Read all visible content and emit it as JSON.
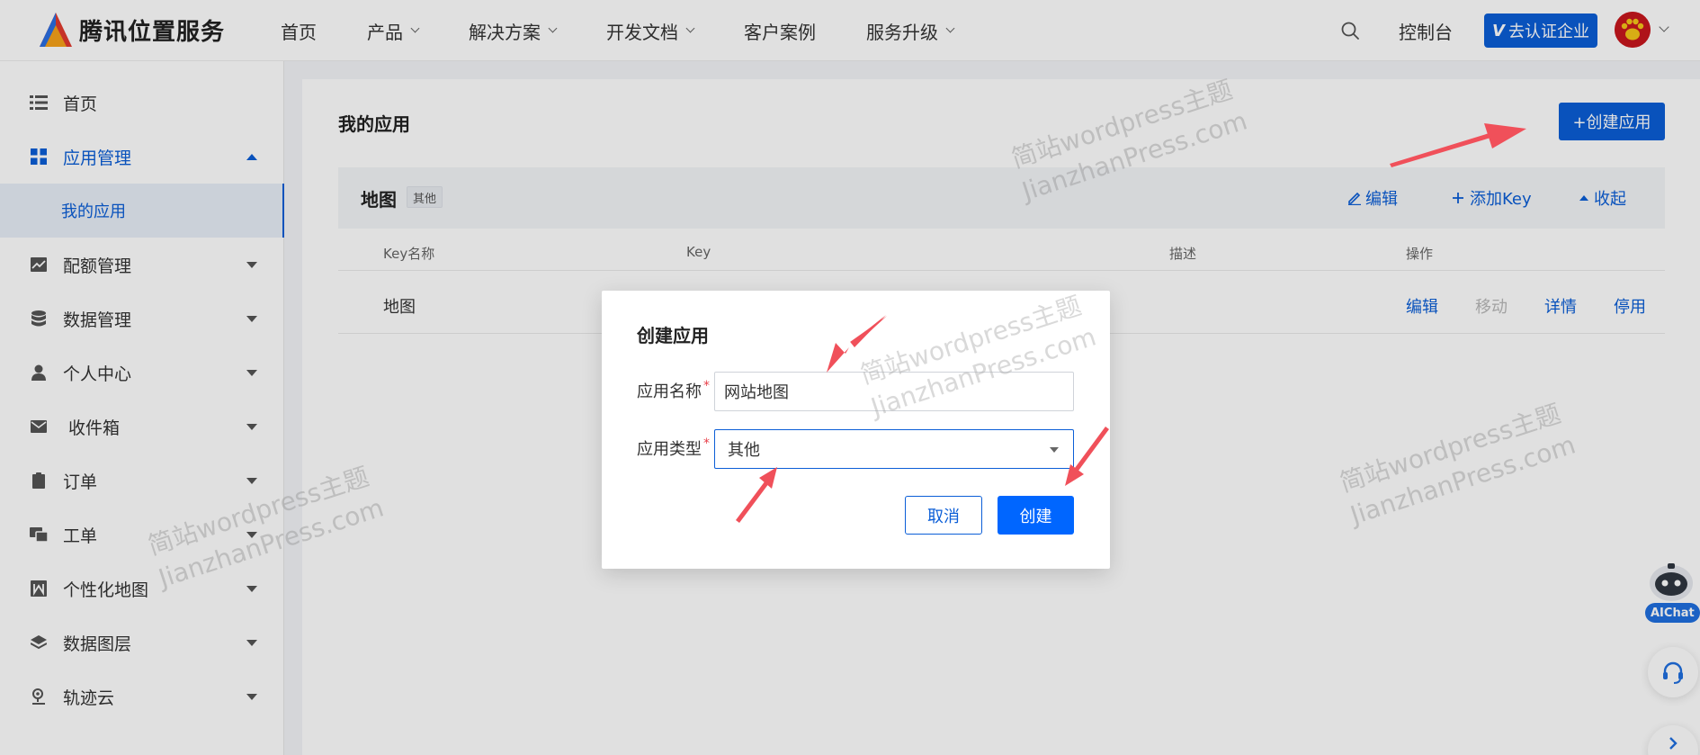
{
  "header": {
    "logo_text": "腾讯位置服务",
    "nav": [
      {
        "label": "首页",
        "has_dropdown": false
      },
      {
        "label": "产品",
        "has_dropdown": true
      },
      {
        "label": "解决方案",
        "has_dropdown": true
      },
      {
        "label": "开发文档",
        "has_dropdown": true
      },
      {
        "label": "客户案例",
        "has_dropdown": false
      },
      {
        "label": "服务升级",
        "has_dropdown": true
      }
    ],
    "console_label": "控制台",
    "verify_badge": "V",
    "verify_label": "去认证企业"
  },
  "sidebar": {
    "items": [
      {
        "label": "首页",
        "icon": "list-icon"
      },
      {
        "label": "应用管理",
        "icon": "grid-icon",
        "expanded": true
      },
      {
        "label": "我的应用",
        "sub": true,
        "selected": true
      },
      {
        "label": "配额管理",
        "icon": "chart-icon"
      },
      {
        "label": "数据管理",
        "icon": "database-icon"
      },
      {
        "label": "个人中心",
        "icon": "user-icon"
      },
      {
        "label": "收件箱",
        "icon": "mail-icon"
      },
      {
        "label": "订单",
        "icon": "clipboard-icon"
      },
      {
        "label": "工单",
        "icon": "ticket-icon"
      },
      {
        "label": "个性化地图",
        "icon": "map-style-icon"
      },
      {
        "label": "数据图层",
        "icon": "layers-icon"
      },
      {
        "label": "轨迹云",
        "icon": "track-icon"
      }
    ]
  },
  "main": {
    "title": "我的应用",
    "create_app_label": "+创建应用",
    "app": {
      "name": "地图",
      "tag": "其他",
      "actions": {
        "edit": "编辑",
        "add_key": "添加Key",
        "collapse": "收起"
      }
    },
    "table": {
      "columns": [
        "Key名称",
        "Key",
        "描述",
        "操作"
      ],
      "rows": [
        {
          "key_name": "地图",
          "key": "",
          "desc": "",
          "ops": [
            "编辑",
            "移动",
            "详情",
            "停用"
          ]
        }
      ]
    }
  },
  "modal": {
    "title": "创建应用",
    "name_label": "应用名称",
    "name_value": "网站地图",
    "type_label": "应用类型",
    "type_value": "其他",
    "required_mark": "*",
    "cancel_label": "取消",
    "create_label": "创建"
  },
  "watermark": {
    "line1": "简站wordpress主题",
    "line2": "JianzhanPress.com"
  },
  "float": {
    "aichat_label": "AIChat"
  },
  "colors": {
    "primary": "#0b5ed7",
    "create_button": "#0066ff",
    "arrow": "#f0505a",
    "required": "#e8404a"
  }
}
